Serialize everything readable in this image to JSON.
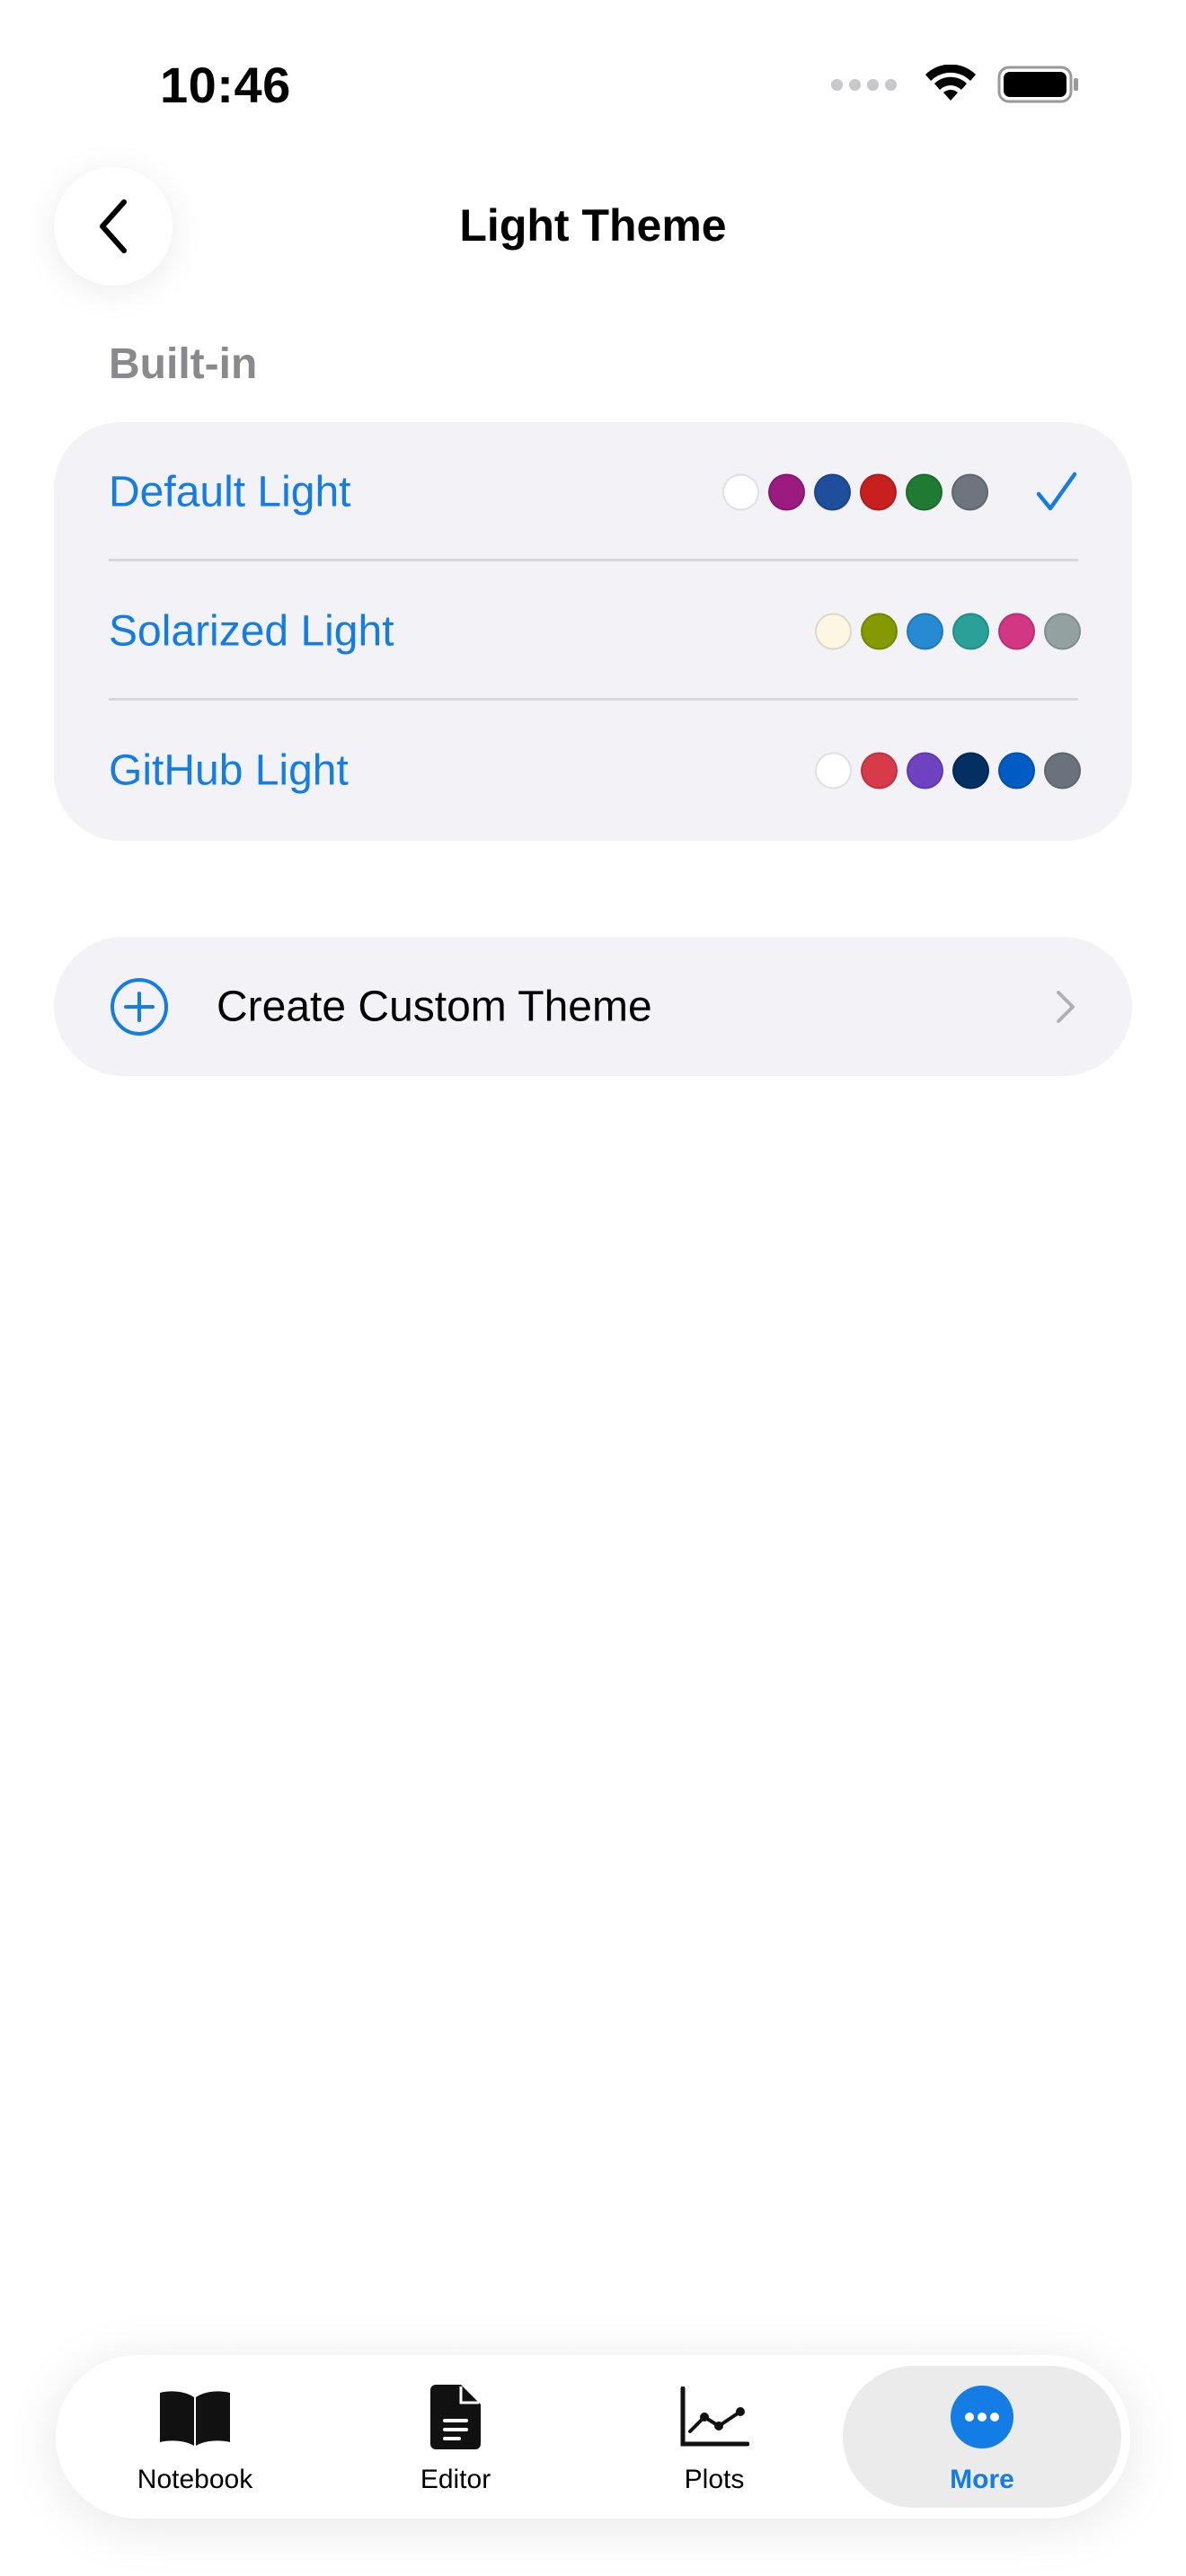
{
  "status_bar": {
    "time": "10:46"
  },
  "nav": {
    "title": "Light Theme",
    "back_icon": "chevron-left-icon"
  },
  "section": {
    "header": "Built-in"
  },
  "themes": [
    {
      "name": "Default Light",
      "selected": true,
      "swatches": [
        "#ffffff",
        "#9b1b80",
        "#1f4f9c",
        "#c81f1f",
        "#1f7a32",
        "#6e757f"
      ]
    },
    {
      "name": "Solarized Light",
      "selected": false,
      "swatches": [
        "#fdf6e3",
        "#859900",
        "#268bd2",
        "#2aa198",
        "#d33682",
        "#93a1a1"
      ]
    },
    {
      "name": "GitHub Light",
      "selected": false,
      "swatches": [
        "#ffffff",
        "#d73a49",
        "#6f42c1",
        "#032f62",
        "#005cc5",
        "#6a737d"
      ]
    }
  ],
  "create": {
    "label": "Create Custom Theme",
    "icon": "plus-circle-icon"
  },
  "tabs": [
    {
      "label": "Notebook",
      "icon": "book-icon",
      "active": false
    },
    {
      "label": "Editor",
      "icon": "document-icon",
      "active": false
    },
    {
      "label": "Plots",
      "icon": "chart-line-icon",
      "active": false
    },
    {
      "label": "More",
      "icon": "more-icon",
      "active": true
    }
  ],
  "colors": {
    "accent": "#147ce5",
    "card_bg": "#f2f2f7",
    "secondary_text": "#8a8a8e"
  }
}
